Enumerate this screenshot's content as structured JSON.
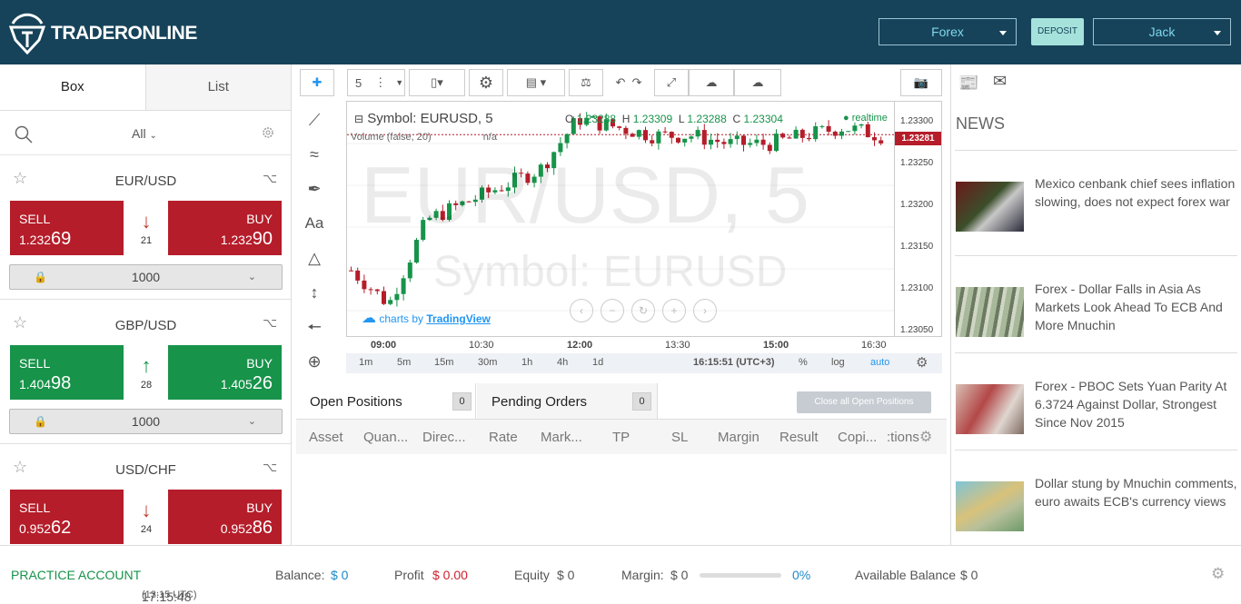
{
  "header": {
    "logo_text": "TRADERONLINE",
    "market_select": "Forex",
    "deposit_label": "DEPOSIT",
    "user_select": "Jack"
  },
  "left_panel": {
    "tabs": [
      "Box",
      "List"
    ],
    "filter_label": "All",
    "instruments": [
      {
        "pair": "EUR/USD",
        "sell_label": "SELL",
        "sell_small": "1.232",
        "sell_big": "69",
        "buy_label": "BUY",
        "buy_small": "1.232",
        "buy_big": "90",
        "direction": "down",
        "spread": "21",
        "quantity": "1000",
        "color": "red"
      },
      {
        "pair": "GBP/USD",
        "sell_label": "SELL",
        "sell_small": "1.404",
        "sell_big": "98",
        "buy_label": "BUY",
        "buy_small": "1.405",
        "buy_big": "26",
        "direction": "up",
        "spread": "28",
        "quantity": "1000",
        "color": "green"
      },
      {
        "pair": "USD/CHF",
        "sell_label": "SELL",
        "sell_small": "0.952",
        "sell_big": "62",
        "buy_label": "BUY",
        "buy_small": "0.952",
        "buy_big": "86",
        "direction": "down",
        "spread": "24",
        "quantity": "",
        "color": "red"
      }
    ]
  },
  "chart": {
    "interval": "5",
    "symbol_legend": "Symbol: EURUSD, 5",
    "ohlc": {
      "o_label": "O",
      "o": "1.23288",
      "h_label": "H",
      "h": "1.23309",
      "l_label": "L",
      "l": "1.23288",
      "c_label": "C",
      "c": "1.23304"
    },
    "realtime": "realtime",
    "volume_legend": "Volume (false, 20)",
    "volume_value": "n/a",
    "watermark_big": "EUR/USD, 5",
    "watermark_small": "Symbol: EURUSD",
    "attribution_prefix": "charts by",
    "attribution_link": "TradingView",
    "current_price": "1.23281",
    "y_ticks": [
      "1.23300",
      "1.23250",
      "1.23200",
      "1.23150",
      "1.23100",
      "1.23050"
    ],
    "x_ticks": [
      "09:00",
      "10:30",
      "12:00",
      "13:30",
      "15:00",
      "16:30"
    ],
    "timeframes": [
      "1m",
      "5m",
      "15m",
      "30m",
      "1h",
      "4h",
      "1d"
    ],
    "clock": "16:15:51 (UTC+3)",
    "percent": "%",
    "log": "log",
    "auto": "auto"
  },
  "chart_data": {
    "type": "line",
    "title": "EUR/USD, 5",
    "xlabel": "",
    "ylabel": "",
    "ylim": [
      1.2304,
      1.2332
    ],
    "x": [
      "08:20",
      "09:00",
      "09:40",
      "10:20",
      "11:00",
      "11:20",
      "11:40",
      "12:00",
      "12:40",
      "13:20",
      "14:00",
      "14:40",
      "15:20",
      "16:00",
      "16:20"
    ],
    "series": [
      {
        "values": [
          1.2312,
          1.2308,
          1.2318,
          1.232,
          1.2322,
          1.2324,
          1.233,
          1.2329,
          1.2328,
          1.2328,
          1.2327,
          1.2327,
          1.2328,
          1.2329,
          1.2328
        ]
      }
    ],
    "grid": true
  },
  "positions": {
    "open_tab": "Open Positions",
    "open_count": "0",
    "pending_tab": "Pending Orders",
    "pending_count": "0",
    "close_all": "Close all Open Positions",
    "columns": [
      "Asset",
      "Quan...",
      "Direc...",
      "Rate",
      "Mark...",
      "TP",
      "SL",
      "Margin",
      "Result",
      "Copi...",
      ":tions"
    ]
  },
  "news": {
    "title": "NEWS",
    "items": [
      "Mexico cenbank chief sees inflation slowing, does not expect forex war",
      "Forex - Dollar Falls in Asia As Markets Look Ahead To ECB And More Mnuchin",
      "Forex - PBOC Sets Yuan Parity At 6.3724 Against Dollar, Strongest Since Nov 2015",
      "Dollar stung by Mnuchin comments, euro awaits ECB's currency views"
    ]
  },
  "footer": {
    "account": "PRACTICE ACCOUNT",
    "time": "17:15:48",
    "time_utc": "(13:15 UTC)",
    "balance_label": "Balance:",
    "balance_value": "$ 0",
    "profit_label": "Profit",
    "profit_value": "$ 0.00",
    "equity_label": "Equity",
    "equity_value": "$ 0",
    "margin_label": "Margin:",
    "margin_value": "$ 0",
    "margin_pct": "0%",
    "available_label": "Available Balance",
    "available_value": "$ 0"
  },
  "colors": {
    "header_bg": "#16435a",
    "sell": "#b51d2a",
    "buy": "#17934a",
    "accent": "#1e88c9"
  }
}
